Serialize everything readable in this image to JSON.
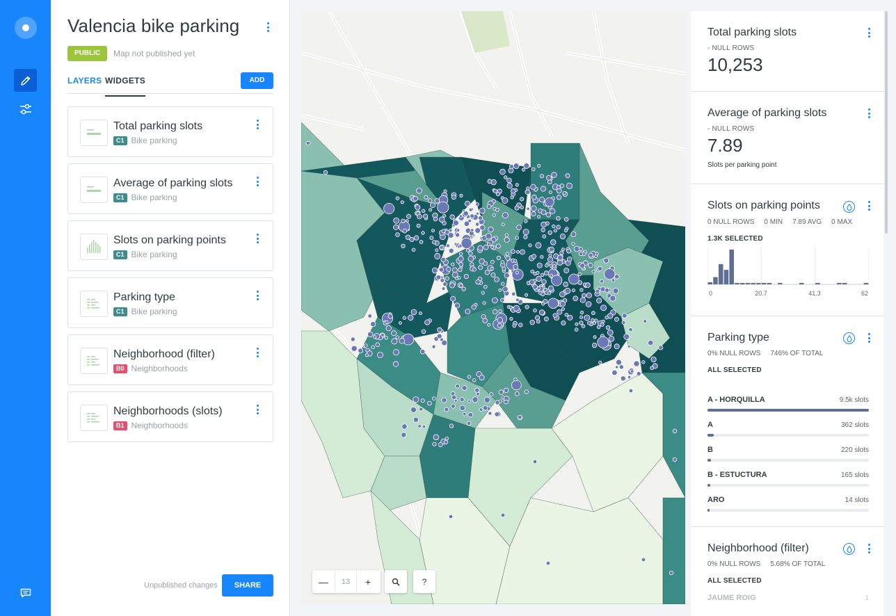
{
  "app": {
    "rail_icons": [
      "logo-icon",
      "pencil-icon",
      "sliders-icon",
      "feedback-icon"
    ]
  },
  "editor": {
    "title": "Valencia bike parking",
    "visibility": "PUBLIC",
    "publish_status": "Map not published yet",
    "tabs": [
      "LAYERS",
      "WIDGETS"
    ],
    "add_label": "ADD",
    "widgets": [
      {
        "title": "Total parking slots",
        "badge": "C1",
        "badge_color": "#3F8C8F",
        "source": "Bike parking",
        "thumb": "formula"
      },
      {
        "title": "Average of parking slots",
        "badge": "C1",
        "badge_color": "#3F8C8F",
        "source": "Bike parking",
        "thumb": "formula"
      },
      {
        "title": "Slots on parking points",
        "badge": "C1",
        "badge_color": "#3F8C8F",
        "source": "Bike parking",
        "thumb": "histogram"
      },
      {
        "title": "Parking type",
        "badge": "C1",
        "badge_color": "#3F8C8F",
        "source": "Bike parking",
        "thumb": "category"
      },
      {
        "title": "Neighborhood (filter)",
        "badge": "B0",
        "badge_color": "#E84F6F",
        "source": "Neighborhoods",
        "thumb": "category"
      },
      {
        "title": "Neighborhoods (slots)",
        "badge": "B1",
        "badge_color": "#E84F6F",
        "source": "Neighborhoods",
        "thumb": "category"
      }
    ],
    "unpublished_label": "Unpublished changes",
    "share_label": "SHARE"
  },
  "map": {
    "zoom_out": "—",
    "zoom_level": "13",
    "zoom_in": "+",
    "help": "?"
  },
  "sidebar_widgets": {
    "total": {
      "title": "Total parking slots",
      "nulls": "- NULL ROWS",
      "value": "10,253"
    },
    "average": {
      "title": "Average of parking slots",
      "nulls": "- NULL ROWS",
      "value": "7.89",
      "description": "Slots per parking point"
    },
    "histogram": {
      "title": "Slots on parking points",
      "stats": [
        "0 NULL ROWS",
        "0 MIN",
        "7.89 AVG",
        "0 MAX"
      ],
      "selected": "1.3K SELECTED",
      "axis": [
        "0",
        "20.7",
        "41.3",
        "62"
      ]
    },
    "parking_type": {
      "title": "Parking type",
      "stats": [
        "0% NULL ROWS",
        "746% OF TOTAL"
      ],
      "selected": "ALL SELECTED",
      "categories": [
        {
          "name": "A - HORQUILLA",
          "value": "9.5k slots",
          "fraction": 1.0
        },
        {
          "name": "A",
          "value": "362 slots",
          "fraction": 0.038
        },
        {
          "name": "B",
          "value": "220 slots",
          "fraction": 0.023
        },
        {
          "name": "B - ESTUCTURA",
          "value": "165 slots",
          "fraction": 0.017
        },
        {
          "name": "ARO",
          "value": "14 slots",
          "fraction": 0.0015
        }
      ]
    },
    "neighborhood": {
      "title": "Neighborhood (filter)",
      "stats": [
        "0% NULL ROWS",
        "5.68% OF TOTAL"
      ],
      "selected": "ALL SELECTED",
      "first_category": "JAUME ROIG",
      "first_value": "1"
    }
  },
  "chart_data": {
    "type": "bar",
    "title": "Slots on parking points",
    "xlim": [
      0,
      62
    ],
    "x_ticks": [
      "0",
      "20.7",
      "41.3",
      "62"
    ],
    "values": [
      3,
      10,
      28,
      20,
      48,
      2,
      2,
      2,
      2,
      2,
      2,
      2,
      0,
      2,
      0,
      0,
      0,
      2,
      0,
      0,
      2,
      0,
      0,
      0,
      2,
      2,
      0,
      0,
      0,
      2
    ]
  }
}
